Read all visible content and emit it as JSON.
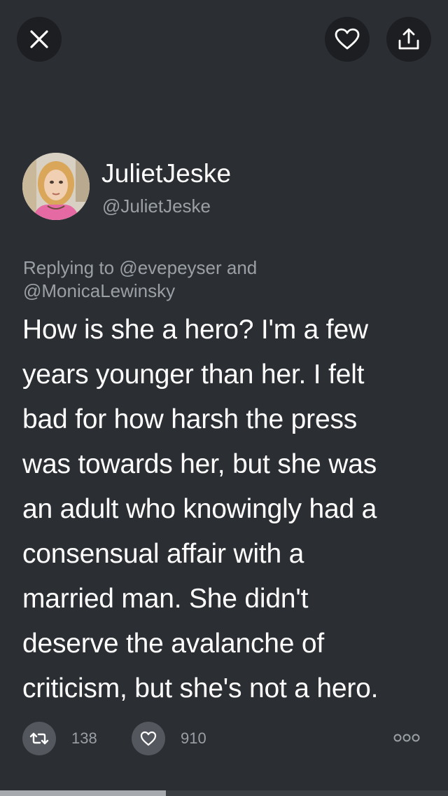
{
  "header": {
    "close_icon": "close-icon",
    "like_icon": "heart-icon",
    "share_icon": "share-icon"
  },
  "author": {
    "display_name": "JulietJeske",
    "handle": "@JulietJeske"
  },
  "tweet": {
    "reply_to": "Replying to @evepeyser and\n@MonicaLewinsky",
    "text": "How is she a hero? I'm a few\nyears younger than her.  I felt\nbad for how harsh the press\nwas towards her, but she was\nan adult who knowingly had a\nconsensual affair with a\nmarried man.  She didn't\ndeserve the avalanche of\ncriticism, but she's not a hero."
  },
  "actions": {
    "retweet_count": "138",
    "like_count": "910",
    "more_icon": "more-icon"
  },
  "progress": {
    "fraction": 0.37
  },
  "colors": {
    "background": "#2b2e33",
    "button_bg": "#1c1e21",
    "secondary_text": "#9aa0a6"
  }
}
